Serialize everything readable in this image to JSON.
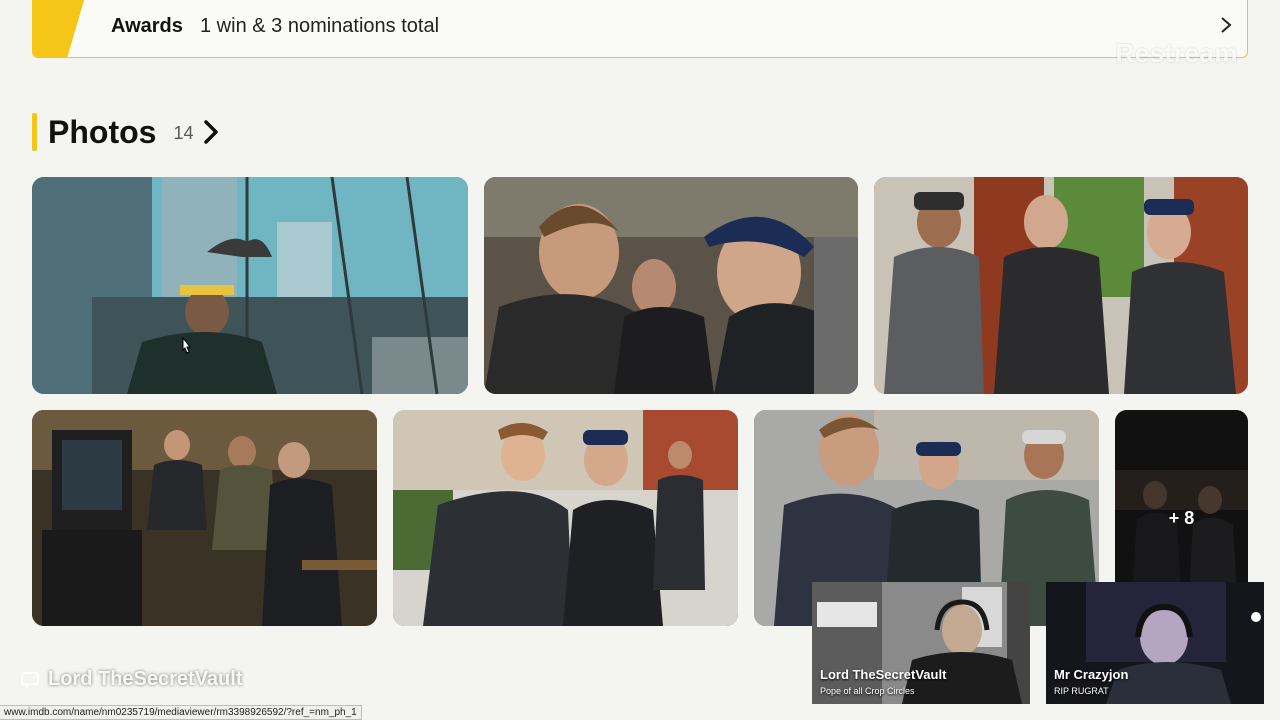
{
  "awards": {
    "label": "Awards",
    "value": "1 win & 3 nominations total"
  },
  "watermark": "Restream",
  "photos": {
    "title": "Photos",
    "count": "14",
    "tiles": [
      {
        "alt": "Man in ear protectors at glass window with pigeon"
      },
      {
        "alt": "Two men talking, one in cap"
      },
      {
        "alt": "Three men standing outside"
      },
      {
        "alt": "Crew seated behind monitor"
      },
      {
        "alt": "Two men smiling on street"
      },
      {
        "alt": "Group on city street"
      },
      {
        "alt": "Night photo",
        "more_label": "+ 8"
      }
    ]
  },
  "cams": [
    {
      "name": "Lord TheSecretVault",
      "subtitle": "Pope of all Crop Circles"
    },
    {
      "name": "Mr Crazyjon",
      "subtitle": "RIP RUGRAT"
    }
  ],
  "speaker": {
    "name": "Lord TheSecretVault"
  },
  "statusbar": {
    "url": "www.imdb.com/name/nm0235719/mediaviewer/rm3398926592/?ref_=nm_ph_1"
  },
  "colors": {
    "accent": "#f5c518",
    "background": "#f4f4f1"
  }
}
